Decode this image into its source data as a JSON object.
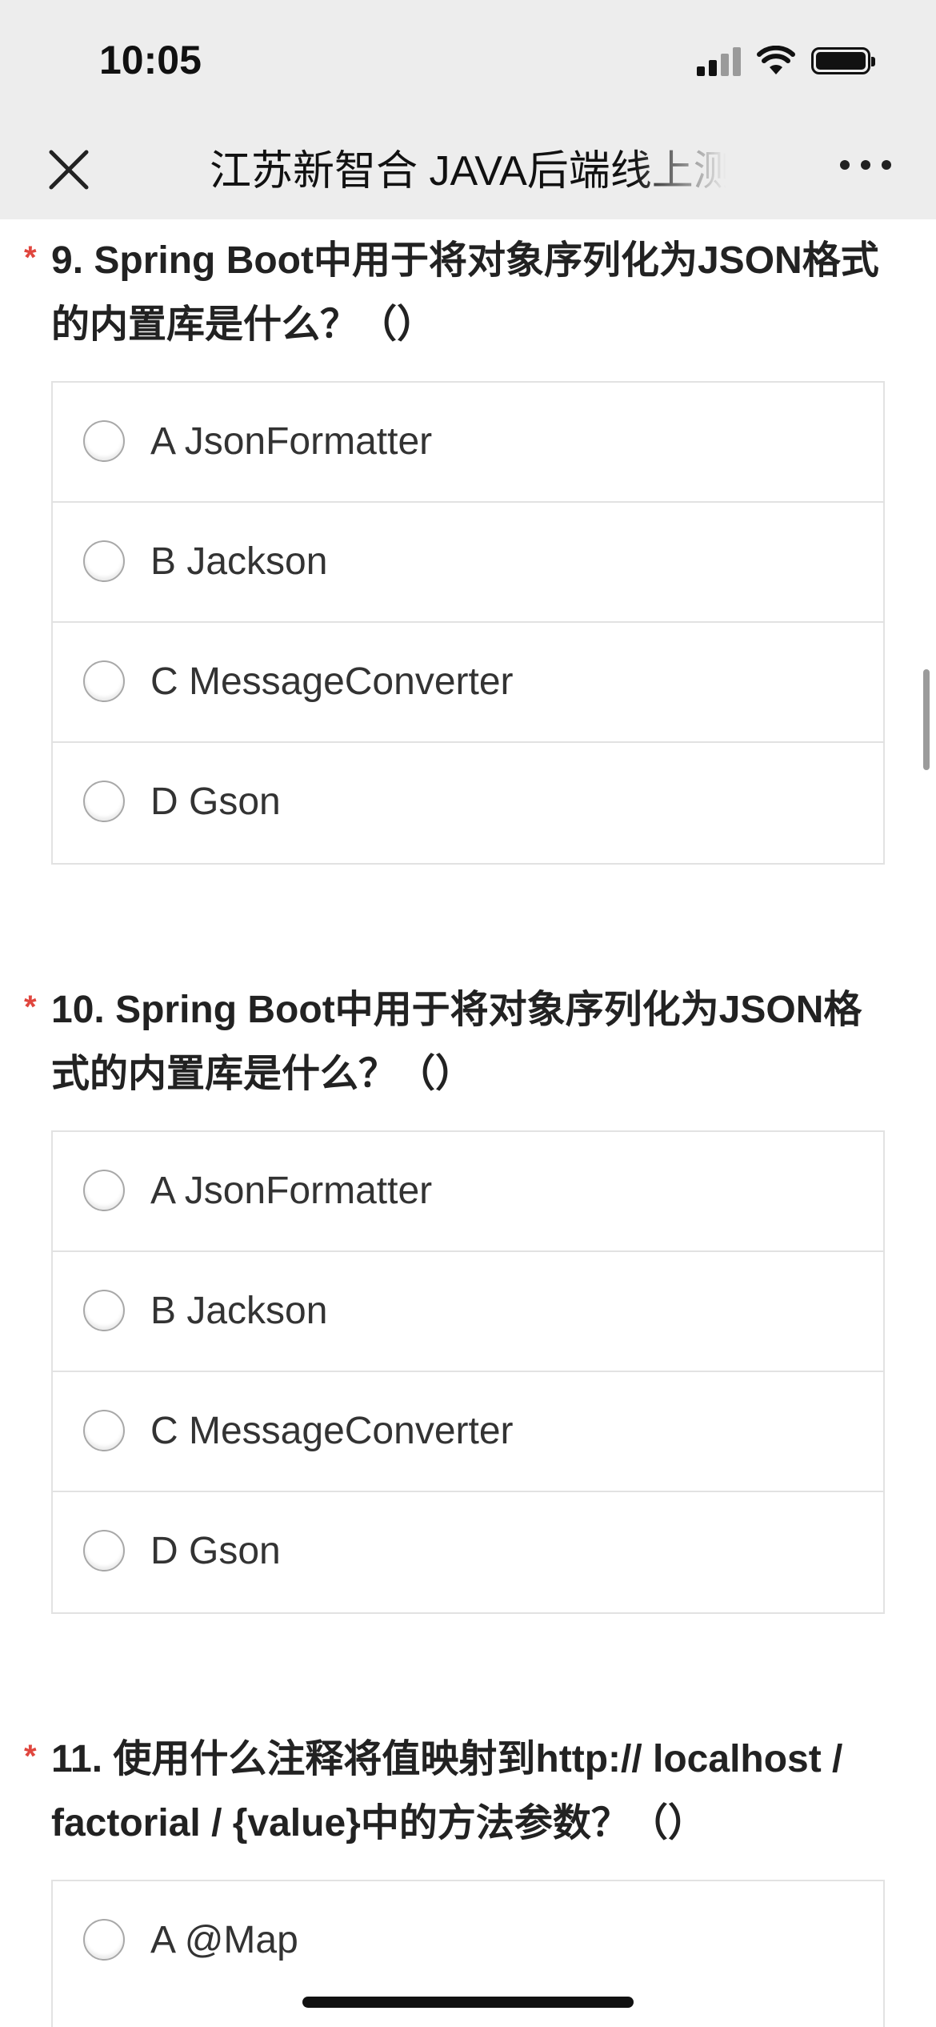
{
  "status_bar": {
    "time": "10:05"
  },
  "nav": {
    "title": "江苏新智合 JAVA后端线上测"
  },
  "questions": [
    {
      "title": "9. Spring Boot中用于将对象序列化为JSON格式的内置库是什么？（）",
      "required_mark": "*",
      "options": [
        {
          "label": "A JsonFormatter"
        },
        {
          "label": "B Jackson"
        },
        {
          "label": "C MessageConverter"
        },
        {
          "label": "D Gson"
        }
      ]
    },
    {
      "title": "10. Spring Boot中用于将对象序列化为JSON格式的内置库是什么？（）",
      "required_mark": "*",
      "options": [
        {
          "label": "A JsonFormatter"
        },
        {
          "label": "B Jackson"
        },
        {
          "label": "C MessageConverter"
        },
        {
          "label": "D Gson"
        }
      ]
    },
    {
      "title": "11. 使用什么注释将值映射到http:// localhost / factorial / {value}中的方法参数？（）",
      "required_mark": "*",
      "options": [
        {
          "label": "A @Map"
        }
      ]
    }
  ]
}
